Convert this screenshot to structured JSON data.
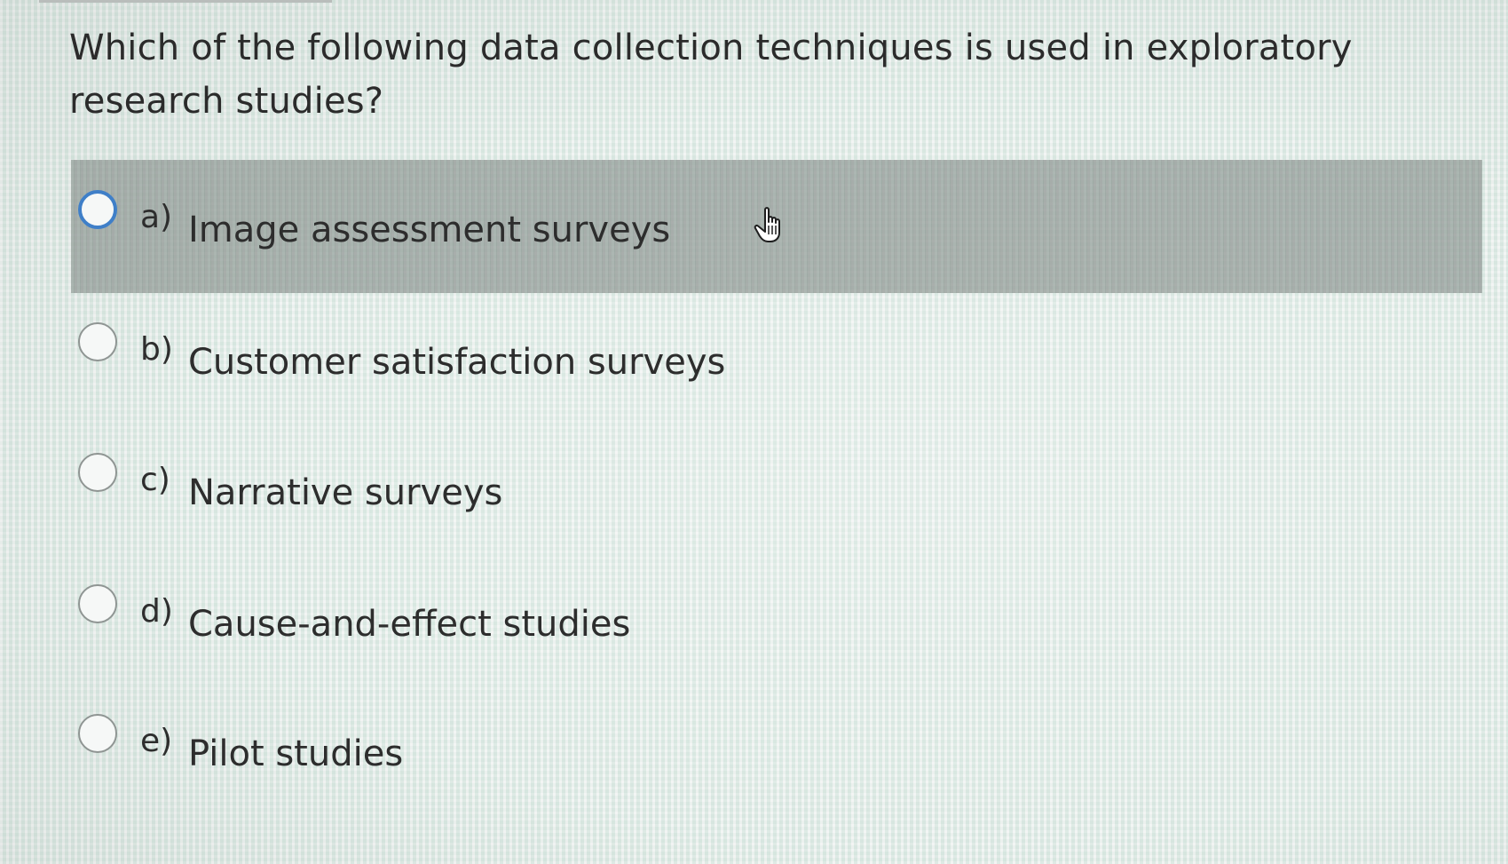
{
  "question": {
    "text": "Which of the following data collection techniques is used in exploratory research studies?"
  },
  "options": [
    {
      "letter": "a)",
      "text": "Image assessment surveys",
      "highlighted": true
    },
    {
      "letter": "b)",
      "text": "Customer satisfaction surveys",
      "highlighted": false
    },
    {
      "letter": "c)",
      "text": "Narrative surveys",
      "highlighted": false
    },
    {
      "letter": "d)",
      "text": "Cause-and-effect studies",
      "highlighted": false
    },
    {
      "letter": "e)",
      "text": "Pilot studies",
      "highlighted": false
    }
  ],
  "colors": {
    "highlight": "#8c9490",
    "radio_focus": "#3f7fc8",
    "text": "#2d2d2d"
  },
  "icons": {
    "cursor": "hand-pointer-icon",
    "radio": "radio-button-icon"
  }
}
